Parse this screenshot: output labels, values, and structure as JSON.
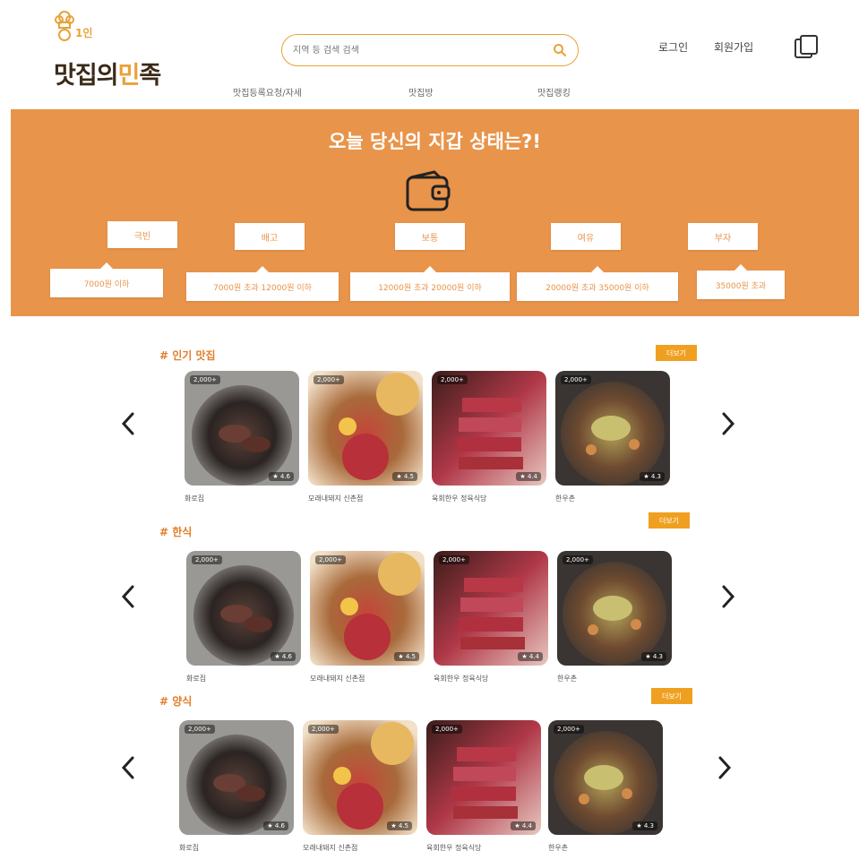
{
  "header": {
    "logo_mini": "1인",
    "logo_part1": "맛집의",
    "logo_part2": "민",
    "logo_part3": "족",
    "search_placeholder": "지역 등 검색 검색",
    "login": "로그인",
    "signup": "회원가입"
  },
  "nav": [
    "맛집등록요청/자세",
    "맛집방",
    "맛집랭킹"
  ],
  "banner": {
    "title": "오늘 당신의 지갑 상태는?!",
    "states": [
      {
        "label": "극빈",
        "range": "7000원 이하"
      },
      {
        "label": "배고",
        "range": "7000원 초과 12000원 이하"
      },
      {
        "label": "보통",
        "range": "12000원 초과 20000원 이하"
      },
      {
        "label": "여유",
        "range": "20000원 초과 35000원 이하"
      },
      {
        "label": "부자",
        "range": "35000원 초과"
      }
    ]
  },
  "sections": [
    {
      "title": "# 인기 맛집",
      "more": "더보기",
      "cards": [
        {
          "name": "화로집",
          "badge": "2,000+",
          "rating": "★ 4.6"
        },
        {
          "name": "모래내돼지 신촌점",
          "badge": "2,000+",
          "rating": "★ 4.5"
        },
        {
          "name": "육회한우 정육식당",
          "badge": "2,000+",
          "rating": "★ 4.4"
        },
        {
          "name": "한우촌",
          "badge": "2,000+",
          "rating": "★ 4.3"
        }
      ]
    },
    {
      "title": "# 한식",
      "more": "더보기",
      "cards": [
        {
          "name": "화로집",
          "badge": "2,000+",
          "rating": "★ 4.6"
        },
        {
          "name": "모래내돼지 신촌점",
          "badge": "2,000+",
          "rating": "★ 4.5"
        },
        {
          "name": "육회한우 정육식당",
          "badge": "2,000+",
          "rating": "★ 4.4"
        },
        {
          "name": "한우촌",
          "badge": "2,000+",
          "rating": "★ 4.3"
        }
      ]
    },
    {
      "title": "# 양식",
      "more": "더보기",
      "cards": [
        {
          "name": "화로집",
          "badge": "2,000+",
          "rating": "★ 4.6"
        },
        {
          "name": "모래내돼지 신촌점",
          "badge": "2,000+",
          "rating": "★ 4.5"
        },
        {
          "name": "육회한우 정육식당",
          "badge": "2,000+",
          "rating": "★ 4.4"
        },
        {
          "name": "한우촌",
          "badge": "2,000+",
          "rating": "★ 4.3"
        }
      ]
    }
  ]
}
